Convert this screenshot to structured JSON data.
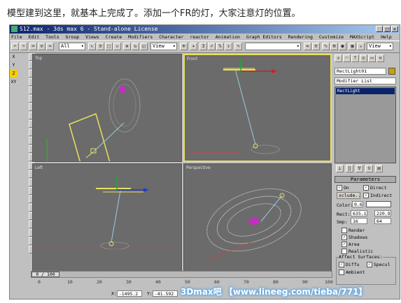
{
  "caption": "模型建到这里，就基本上完成了。添加一个FR的灯，大家注意灯的位置。",
  "window": {
    "title": "S12.max - 3ds max 6 - Stand-alone License"
  },
  "menu": [
    "File",
    "Edit",
    "Tools",
    "Group",
    "Views",
    "Create",
    "Modifiers",
    "Character",
    "reactor",
    "Animation",
    "Graph Editors",
    "Rendering",
    "Customize",
    "MAXScript",
    "Help"
  ],
  "toolbar": {
    "selection_filter": "All",
    "ref_coord": "View",
    "ref_coord_right": "View",
    "named_selection": ""
  },
  "left_toolbar": [
    "X",
    "Y",
    "Z",
    "XY"
  ],
  "viewports": {
    "top": "Top",
    "front": "Front",
    "left": "Left",
    "perspective": "Perspective"
  },
  "command_panel": {
    "object_name": "RectLight01",
    "modifier_list": "Modifier List",
    "stack_item": "RectLight",
    "rollout_title": "Parameters",
    "on_label": "On",
    "on_checked": true,
    "direct_label": "Direct",
    "direct_checked": true,
    "exclude_button": "xclude...",
    "indirect_label": "Indirect",
    "indirect_checked": true,
    "color_label": "Color:",
    "color_value": "0.6",
    "color_swatch": "#ffffff",
    "rect_label": "Rect:",
    "rect_w": "635.1",
    "rect_h": "220.9",
    "smp_label": "Smp:",
    "smp_a": "16",
    "smp_b": "64",
    "render_label": "Render",
    "render_checked": false,
    "shadows_label": "Shadows",
    "shadows_checked": true,
    "area_label": "Area",
    "area_checked": true,
    "realistic_label": "Realistic",
    "realistic_checked": false,
    "affect_label": "Affect Surfaces:",
    "diffu_label": "Diffu",
    "diffu_checked": true,
    "specul_label": "Specul",
    "specul_checked": true,
    "ambient_label": "Ambient"
  },
  "time_slider": {
    "label": "0 / 100"
  },
  "ruler_ticks": [
    "0",
    "10",
    "20",
    "30",
    "40",
    "50",
    "60",
    "70",
    "80",
    "90",
    "100"
  ],
  "coords": {
    "x_label": "X:",
    "x_value": "-1495.2",
    "y_label": "Y:",
    "y_value": "-41.592"
  },
  "watermark": "3Dmax吧 【www.lineeg.com/tieba/771】"
}
